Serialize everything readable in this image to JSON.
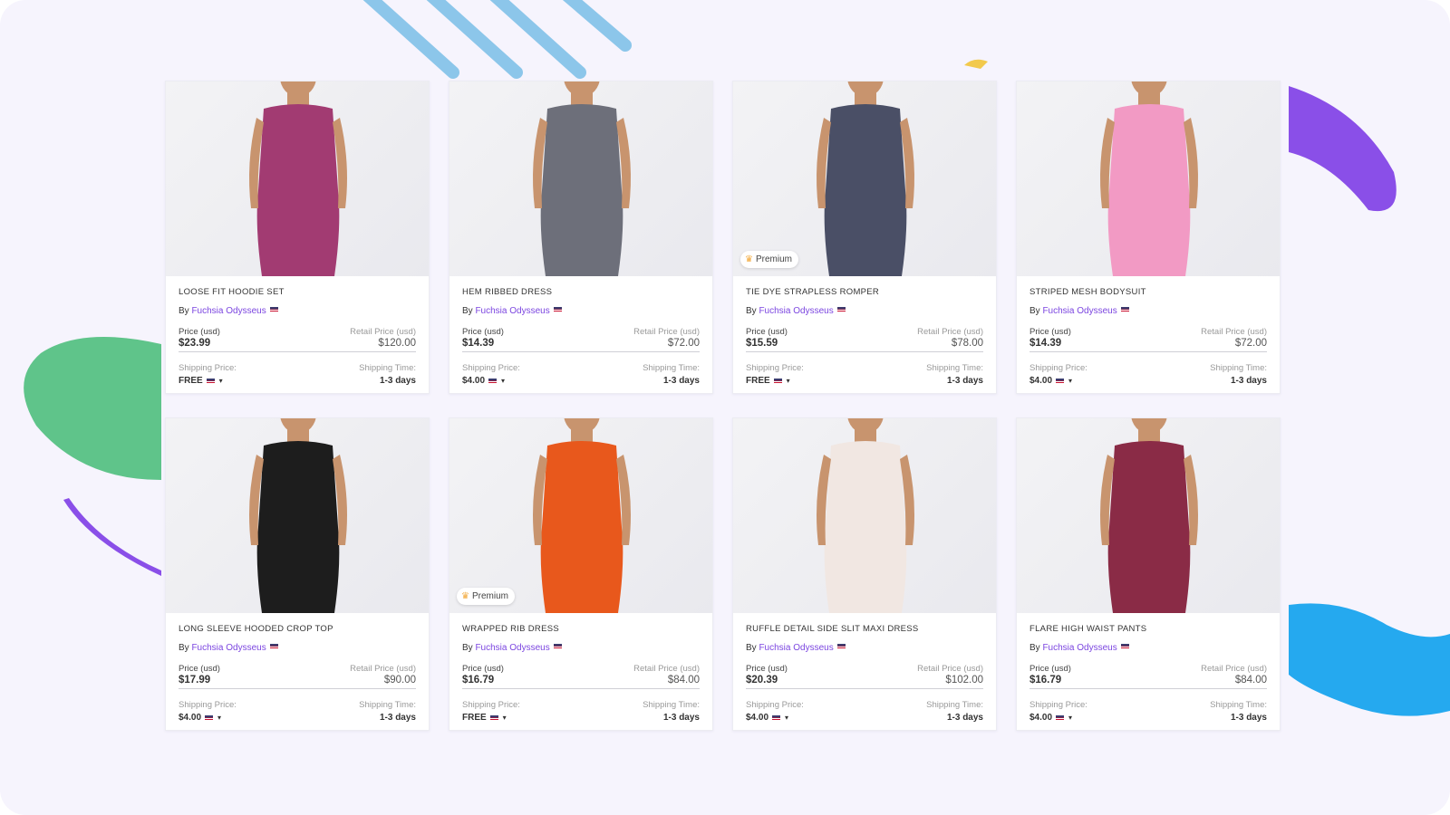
{
  "labels": {
    "by": "By",
    "price": "Price (usd)",
    "retail": "Retail Price (usd)",
    "ship_price": "Shipping Price:",
    "ship_time": "Shipping Time:"
  },
  "products": [
    {
      "title": "LOOSE FIT HOODIE SET",
      "seller": "Fuchsia Odysseus",
      "price": "$23.99",
      "retail": "$120.00",
      "shipping": "FREE",
      "time": "1-3 days",
      "premium": "",
      "color": "#a23b72"
    },
    {
      "title": "HEM RIBBED DRESS",
      "seller": "Fuchsia Odysseus",
      "price": "$14.39",
      "retail": "$72.00",
      "shipping": "$4.00",
      "time": "1-3 days",
      "premium": "",
      "color": "#6d6f7a"
    },
    {
      "title": "TIE DYE STRAPLESS ROMPER",
      "seller": "Fuchsia Odysseus",
      "price": "$15.59",
      "retail": "$78.00",
      "shipping": "FREE",
      "time": "1-3 days",
      "premium": "Premium",
      "color": "#4a4f66"
    },
    {
      "title": "STRIPED MESH BODYSUIT",
      "seller": "Fuchsia Odysseus",
      "price": "$14.39",
      "retail": "$72.00",
      "shipping": "$4.00",
      "time": "1-3 days",
      "premium": "",
      "color": "#f29ac4"
    },
    {
      "title": "LONG SLEEVE HOODED CROP TOP",
      "seller": "Fuchsia Odysseus",
      "price": "$17.99",
      "retail": "$90.00",
      "shipping": "$4.00",
      "time": "1-3 days",
      "premium": "",
      "color": "#1d1d1d"
    },
    {
      "title": "WRAPPED RIB DRESS",
      "seller": "Fuchsia Odysseus",
      "price": "$16.79",
      "retail": "$84.00",
      "shipping": "FREE",
      "time": "1-3 days",
      "premium": "Premium",
      "color": "#e8581c"
    },
    {
      "title": "RUFFLE DETAIL SIDE SLIT MAXI DRESS",
      "seller": "Fuchsia Odysseus",
      "price": "$20.39",
      "retail": "$102.00",
      "shipping": "$4.00",
      "time": "1-3 days",
      "premium": "",
      "color": "#f1e7e2"
    },
    {
      "title": "FLARE HIGH WAIST PANTS",
      "seller": "Fuchsia Odysseus",
      "price": "$16.79",
      "retail": "$84.00",
      "shipping": "$4.00",
      "time": "1-3 days",
      "premium": "",
      "color": "#8a2b46"
    }
  ],
  "icons": {
    "crown": "crown-icon",
    "flag": "us-flag-icon",
    "caret": "caret-down-icon"
  },
  "colors": {
    "accent": "#7b45e0",
    "background": "#f6f4fd"
  }
}
